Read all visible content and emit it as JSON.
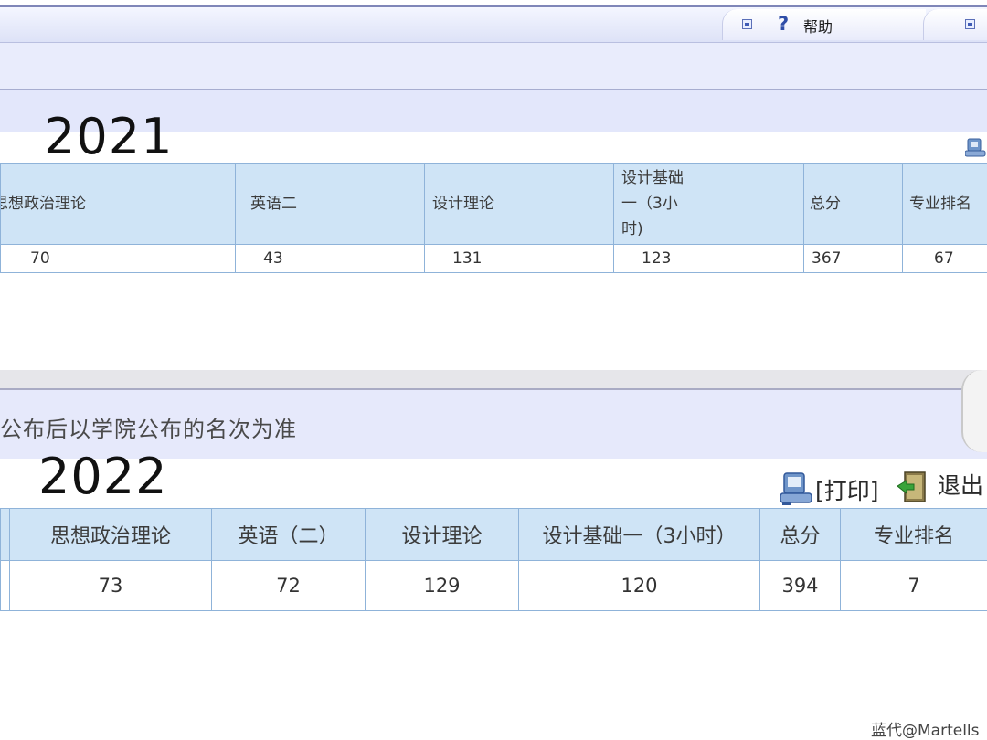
{
  "toolbar": {
    "help_label": "帮助",
    "help_icon": "help-question-icon"
  },
  "panel2021": {
    "year": "2021",
    "headers": [
      "思想政治理论",
      "英语二",
      "设计理论",
      "设计基础一（3小时)",
      "总分",
      "专业排名"
    ],
    "values": [
      "70",
      "43",
      "131",
      "123",
      "367",
      "67"
    ]
  },
  "panel2022": {
    "notice": "公布后以学院公布的名次为准",
    "year": "2022",
    "print_label": "[打印]",
    "exit_label": "退出",
    "headers": [
      "思想政治理论",
      "英语（二）",
      "设计理论",
      "设计基础一（3小时）",
      "总分",
      "专业排名"
    ],
    "values": [
      "73",
      "72",
      "129",
      "120",
      "394",
      "7"
    ]
  },
  "watermark": "蓝代@Martells",
  "colors": {
    "header_bg": "#cfe4f6",
    "grid": "#8fb3d9",
    "band": "#e6e9fb",
    "accent": "#2f4ea8"
  }
}
